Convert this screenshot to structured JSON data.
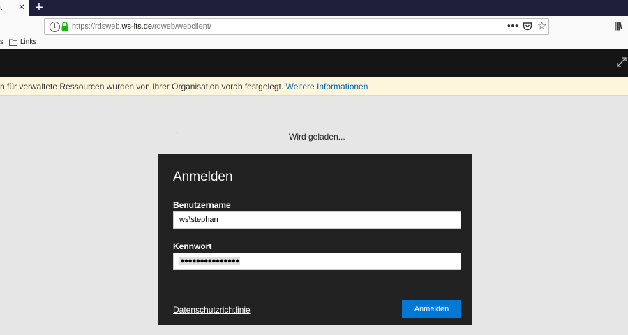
{
  "browser": {
    "tab_title_fragment": "t",
    "tab_close": "×",
    "new_tab": "+",
    "url_prefix": "https://rdsweb.",
    "url_domain": "ws-its.de",
    "url_path": "/rdweb/webclient/",
    "url_more": "•••",
    "bookmarks": {
      "prev_fragment": "s",
      "links_label": "Links"
    }
  },
  "infobar": {
    "text": "n für verwaltete Ressourcen wurden von Ihrer Organisation vorab festgelegt. ",
    "link": "Weitere Informationen"
  },
  "loading_text": "Wird geladen...",
  "login_dialog": {
    "title": "Anmelden",
    "username_label": "Benutzername",
    "username_value": "ws\\stephan",
    "password_label": "Kennwort",
    "password_mask": "●●●●●●●●●●●●●●●",
    "privacy_link": "Datenschutzrichtlinie",
    "submit_label": "Anmelden"
  },
  "colors": {
    "tabbar": "#1f1f3c",
    "accent": "#0078d4",
    "dialog_bg": "#222222",
    "infobar_bg": "#fdf6dc"
  },
  "icons": [
    "close-icon",
    "plus-icon",
    "info-icon",
    "lock-icon",
    "more-icon",
    "pocket-icon",
    "star-icon",
    "library-icon",
    "folder-icon",
    "expand-icon"
  ]
}
